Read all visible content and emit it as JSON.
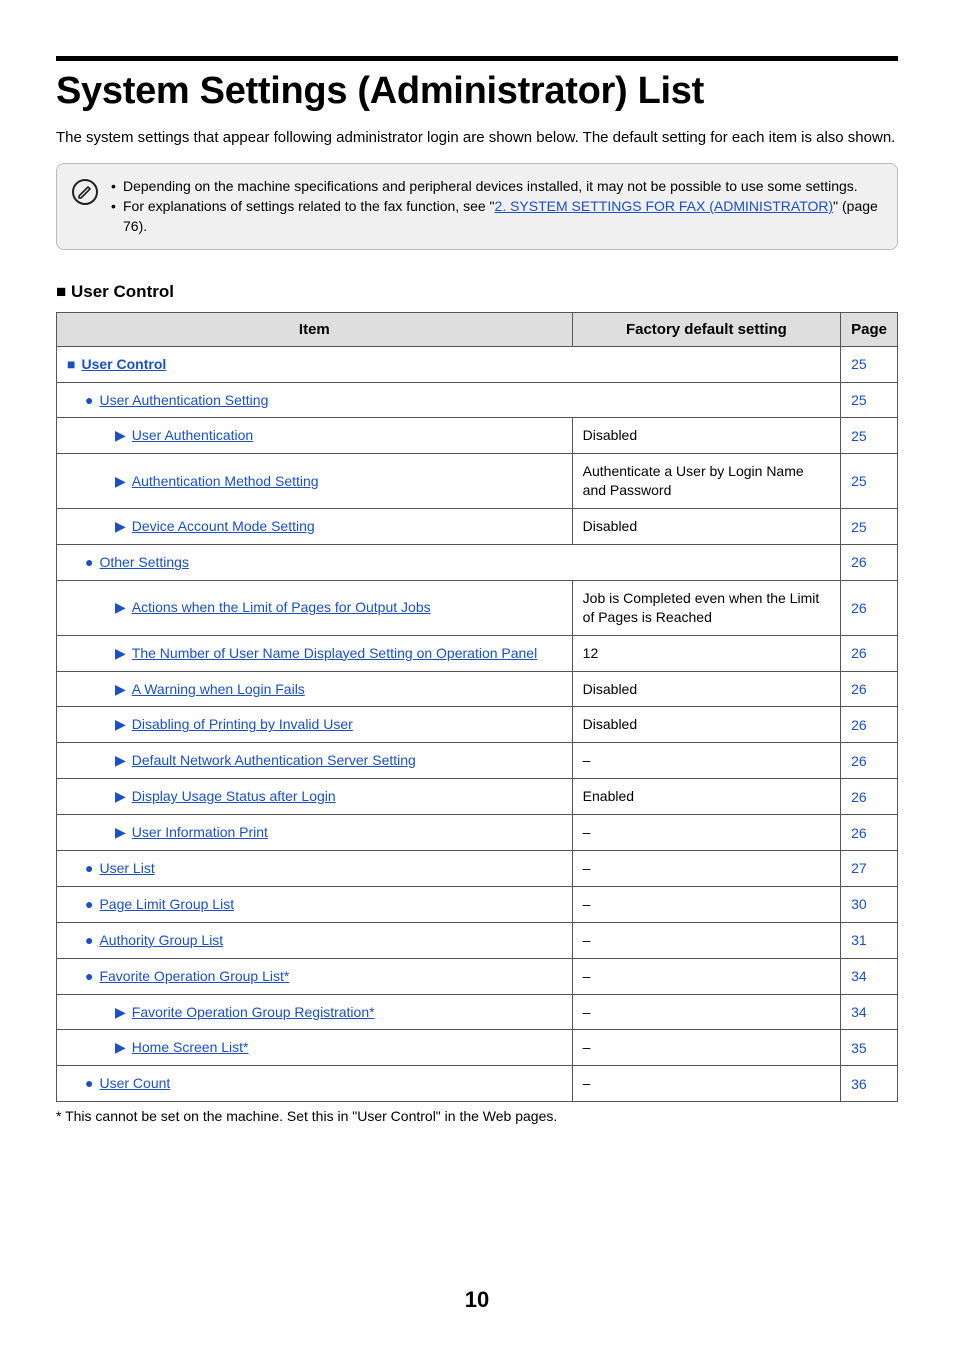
{
  "heading": "System Settings (Administrator) List",
  "intro": "The system settings that appear following administrator login are shown below. The default setting for each item is also shown.",
  "note": {
    "bullets": [
      {
        "pre": "Depending on the machine specifications and peripheral devices installed, it may not be possible to use some settings.",
        "link": "",
        "post": ""
      },
      {
        "pre": "For explanations of settings related to the fax function, see \"",
        "link": "2. SYSTEM SETTINGS FOR FAX (ADMINISTRATOR)",
        "post": "\" (page 76)."
      }
    ]
  },
  "section_title": "User Control",
  "table": {
    "headers": {
      "item": "Item",
      "fds": "Factory default setting",
      "page": "Page"
    },
    "rows": [
      {
        "level": 0,
        "marker": "■",
        "label": "User Control",
        "span": true,
        "fds": "",
        "page": "25"
      },
      {
        "level": 1,
        "marker": "●",
        "label": "User Authentication Setting",
        "span": true,
        "fds": "",
        "page": "25"
      },
      {
        "level": 2,
        "marker": "▶",
        "label": "User Authentication",
        "fds": "Disabled",
        "page": "25"
      },
      {
        "level": 2,
        "marker": "▶",
        "label": "Authentication Method Setting",
        "fds": "Authenticate a User by Login Name and Password",
        "page": "25"
      },
      {
        "level": 2,
        "marker": "▶",
        "label": "Device Account Mode Setting",
        "fds": "Disabled",
        "page": "25"
      },
      {
        "level": 1,
        "marker": "●",
        "label": "Other Settings",
        "span": true,
        "fds": "",
        "page": "26"
      },
      {
        "level": 2,
        "marker": "▶",
        "label": "Actions when the Limit of Pages for Output Jobs",
        "fds": "Job is Completed even when the Limit of Pages is Reached",
        "page": "26"
      },
      {
        "level": 2,
        "marker": "▶",
        "label": "The Number of User Name Displayed Setting on Operation Panel",
        "fds": "12",
        "page": "26"
      },
      {
        "level": 2,
        "marker": "▶",
        "label": "A Warning when Login Fails",
        "fds": "Disabled",
        "page": "26"
      },
      {
        "level": 2,
        "marker": "▶",
        "label": "Disabling of Printing by Invalid User",
        "fds": "Disabled",
        "page": "26"
      },
      {
        "level": 2,
        "marker": "▶",
        "label": "Default Network Authentication Server Setting",
        "fds": "–",
        "page": "26"
      },
      {
        "level": 2,
        "marker": "▶",
        "label": "Display Usage Status after Login",
        "fds": "Enabled",
        "page": "26"
      },
      {
        "level": 2,
        "marker": "▶",
        "label": "User Information Print",
        "fds": "–",
        "page": "26"
      },
      {
        "level": 1,
        "marker": "●",
        "label": "User List",
        "fds": "–",
        "page": "27"
      },
      {
        "level": 1,
        "marker": "●",
        "label": "Page Limit Group List",
        "fds": "–",
        "page": "30"
      },
      {
        "level": 1,
        "marker": "●",
        "label": "Authority Group List",
        "fds": "–",
        "page": "31"
      },
      {
        "level": 1,
        "marker": "●",
        "label": "Favorite Operation Group List*",
        "fds": "–",
        "page": "34"
      },
      {
        "level": 2,
        "marker": "▶",
        "label": "Favorite Operation Group Registration*",
        "fds": "–",
        "page": "34"
      },
      {
        "level": 2,
        "marker": "▶",
        "label": "Home Screen List*",
        "fds": "–",
        "page": "35"
      },
      {
        "level": 1,
        "marker": "●",
        "label": "User Count",
        "fds": "–",
        "page": "36"
      }
    ]
  },
  "footnote": "*  This cannot be set on the machine. Set this in \"User Control\" in the Web pages.",
  "page_number": "10"
}
